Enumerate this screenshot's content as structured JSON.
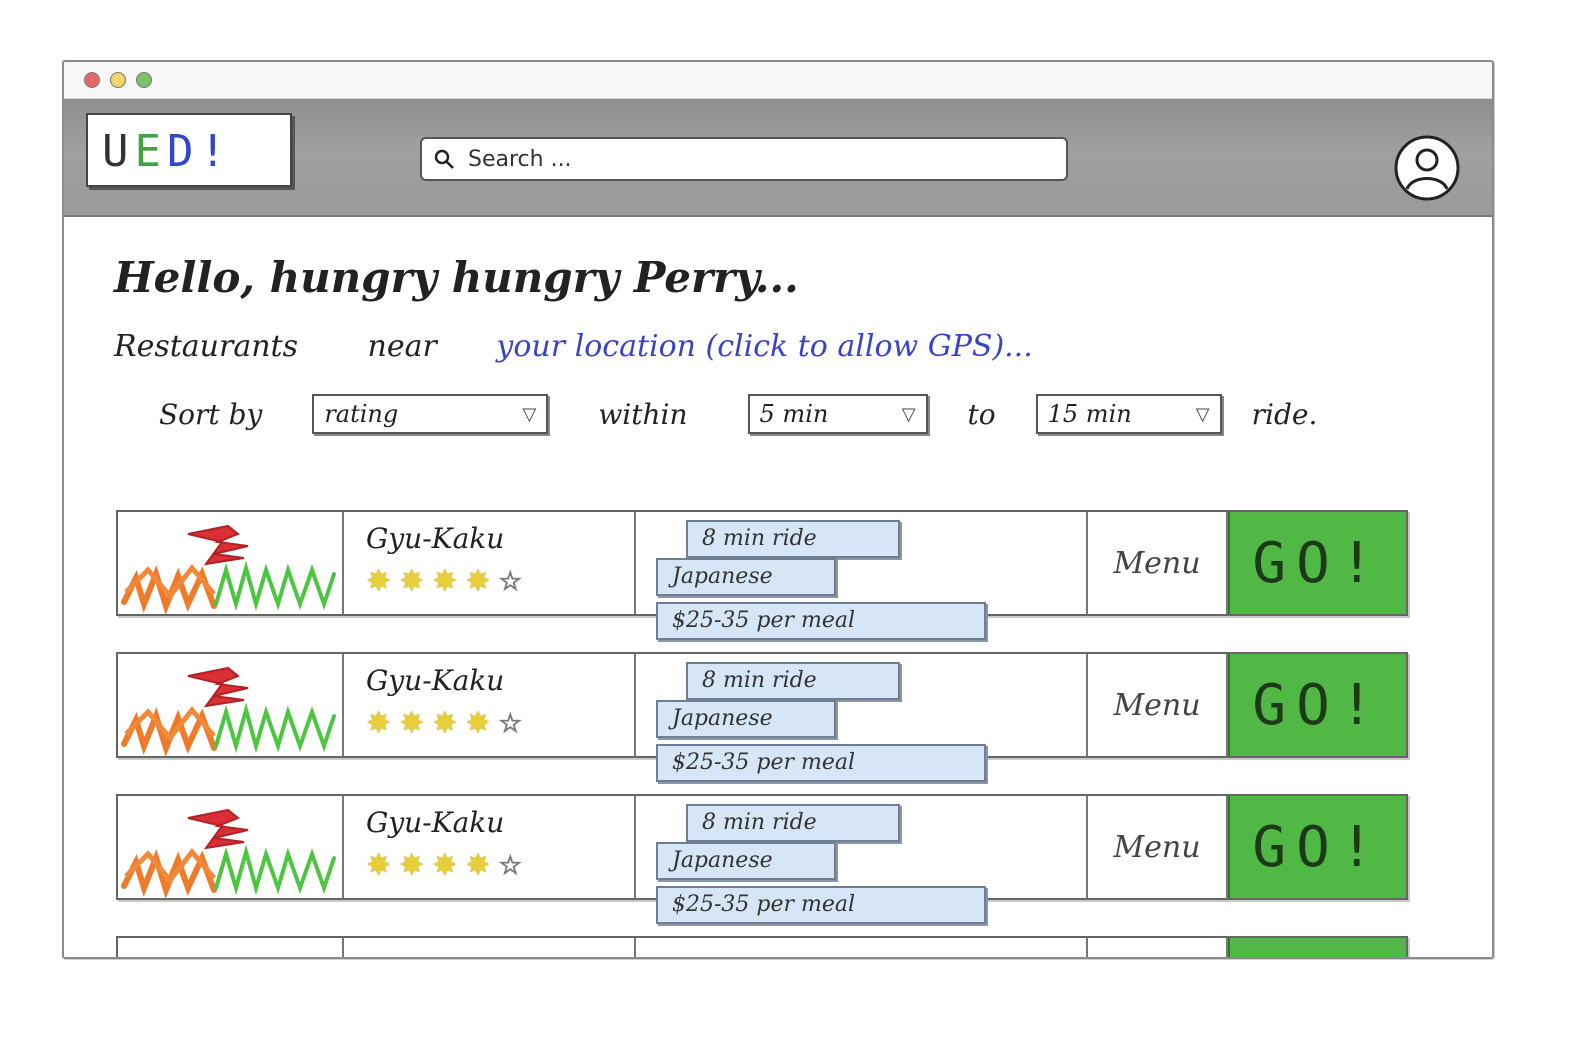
{
  "logo": {
    "letters": [
      "U",
      "E",
      "D",
      "!"
    ],
    "colors": [
      "#333333",
      "#3fa540",
      "#2d48c9",
      "#2d48c9"
    ]
  },
  "search": {
    "placeholder": "Search ...",
    "icon": "search-icon"
  },
  "profile": {
    "icon": "user-avatar-icon"
  },
  "greeting": "Hello, hungry hungry Perry...",
  "location_line": {
    "prefix": "Restaurants",
    "near": "near",
    "link": "your location (click to allow GPS)..."
  },
  "sort": {
    "label": "Sort by",
    "by_value": "rating",
    "within_label": "within",
    "min_value": "5 min",
    "to_label": "to",
    "max_value": "15 min",
    "suffix": "ride."
  },
  "restaurants": [
    {
      "name": "Gyu-Kaku",
      "rating": 4,
      "max_rating": 5,
      "ride": "8 min ride",
      "cuisine": "Japanese",
      "price": "$25-35 per meal",
      "menu": "Menu",
      "go": "GO!"
    },
    {
      "name": "Gyu-Kaku",
      "rating": 4,
      "max_rating": 5,
      "ride": "8 min ride",
      "cuisine": "Japanese",
      "price": "$25-35 per meal",
      "menu": "Menu",
      "go": "GO!"
    },
    {
      "name": "Gyu-Kaku",
      "rating": 4,
      "max_rating": 5,
      "ride": "8 min ride",
      "cuisine": "Japanese",
      "price": "$25-35 per meal",
      "menu": "Menu",
      "go": "GO!"
    }
  ],
  "colors": {
    "go_button": "#52b845",
    "tag_bg": "#d7e6f6",
    "link": "#3943c4",
    "header": "#9a9a9a"
  }
}
